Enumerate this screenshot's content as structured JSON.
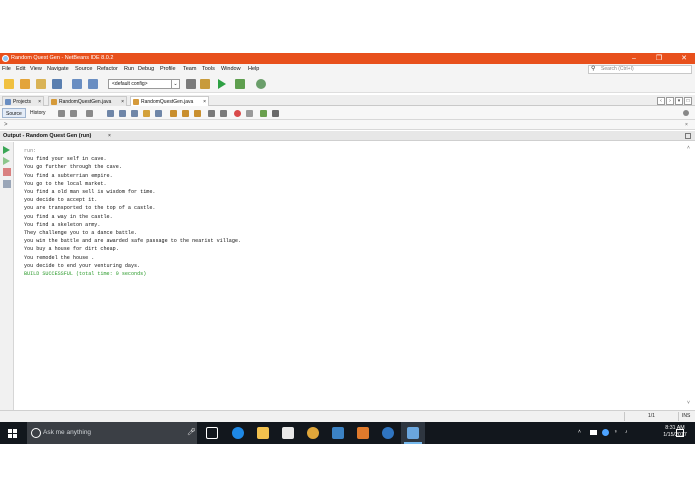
{
  "window": {
    "title": "Random Quest Gen - NetBeans IDE 8.0.2",
    "minimize_glyph": "–",
    "maximize_glyph": "❐",
    "close_glyph": "✕"
  },
  "menu": {
    "items": [
      "File",
      "Edit",
      "View",
      "Navigate",
      "Source",
      "Refactor",
      "Run",
      "Debug",
      "Profile",
      "Team",
      "Tools",
      "Window",
      "Help"
    ],
    "search_placeholder": "Search (Ctrl+I)"
  },
  "toolbar": {
    "config_value": "<default config>"
  },
  "tabs": [
    {
      "label": "Projects",
      "close": "×"
    },
    {
      "label": "RandomQuestGen.java",
      "close": "×"
    },
    {
      "label": "RandomQuestGen.java",
      "close": "×",
      "active": true
    }
  ],
  "editor_subtabs": {
    "source": "Source",
    "history": "History"
  },
  "nav_arrow": ">",
  "output": {
    "title": "Output - Random Quest Gen (run)",
    "close": "×",
    "lines": [
      "run:",
      "You find your self in cave.",
      "You go further through the cave.",
      "You find a subterrian empire.",
      "You go to the local market.",
      "You find a old man sell is wisdom for time.",
      "you decide to accept it.",
      "you are transported to the top of a castle.",
      "you find a way in the castle.",
      "You find a skeleton army.",
      "They challenge you to a dance battle.",
      "you win the battle and are awarded safe passage to the nearist village.",
      "You buy a house for dirt cheap.",
      "You remodel the house .",
      "you decide to end your venturing days.",
      "BUILD SUCCESSFUL (total time: 0 seconds)"
    ]
  },
  "status": {
    "position": "1/1",
    "mode": "INS"
  },
  "taskbar": {
    "search_placeholder": "Ask me anything",
    "time": "8:31 AM",
    "date": "1/15/2017"
  },
  "colors": {
    "titlebar": "#e8501c",
    "taskbar": "#12171d",
    "build_success": "#2a9a2a"
  }
}
